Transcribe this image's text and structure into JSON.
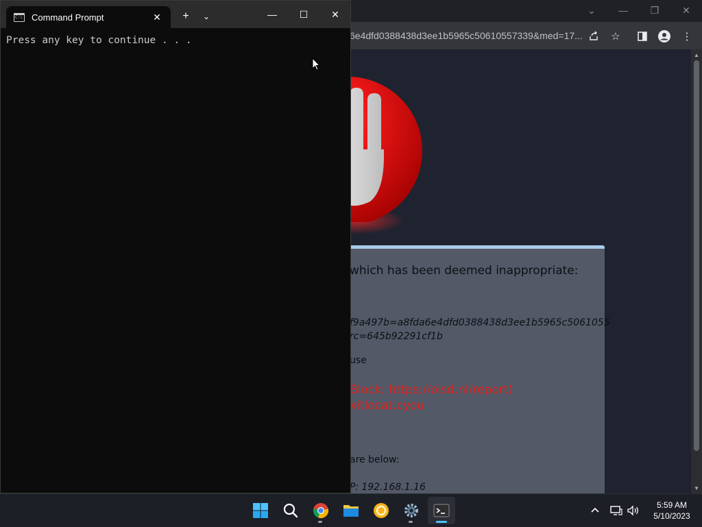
{
  "browser": {
    "url_partial": "6e4dfd0388438d3ee1b5965c50610557339&med=17...",
    "window_controls": [
      "chevron-down-icon",
      "minimize-icon",
      "restore-icon",
      "close-icon"
    ],
    "toolbar_icons": [
      "share-icon",
      "star-icon",
      "side-panel-icon",
      "profile-icon",
      "more-icon"
    ]
  },
  "blocked_page": {
    "heading": "which has been deemed inappropriate:",
    "hash_line1": "f9a497b=a8fda6e4dfd0388438d3ee1b5965c5061055",
    "hash_line2": "rc=645b92291cf1b",
    "cause_label": "use",
    "reason_line1": "Block: https://oisd.nl/report)",
    "reason_line2": "xitlocat.cyou",
    "details_label": "are below:",
    "ip_line": "P: 192.168.1.16"
  },
  "cmd": {
    "tab_title": "Command Prompt",
    "output": "Press any key to continue . . .",
    "icon_glyph": "C:\\"
  },
  "taskbar": {
    "apps": [
      "windows-start-icon",
      "search-icon",
      "chrome-icon",
      "file-explorer-icon",
      "yellow-app-icon",
      "settings-icon",
      "terminal-icon"
    ],
    "clock_time": "5:59 AM",
    "clock_date": "5/10/2023"
  },
  "colors": {
    "terminal_bg": "#0c0c0c",
    "card_bg": "#545967",
    "card_border": "#a9cbe9",
    "reason_red": "#e0211c",
    "taskbar_accent": "#4cc2ff"
  }
}
